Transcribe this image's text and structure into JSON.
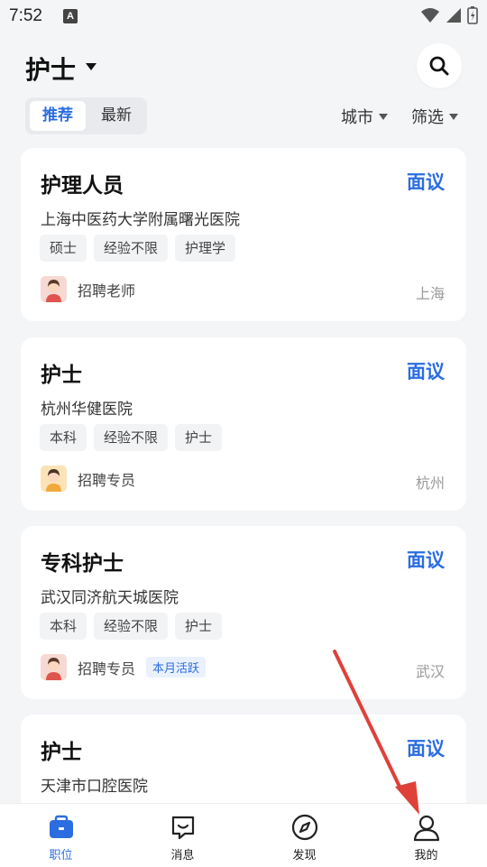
{
  "status": {
    "time": "7:52",
    "notify_glyph": "A"
  },
  "header": {
    "title": "护士"
  },
  "tabs": [
    {
      "label": "推荐"
    },
    {
      "label": "最新"
    }
  ],
  "filters": {
    "city": "城市",
    "filter": "筛选"
  },
  "jobs": [
    {
      "title": "护理人员",
      "salary": "面议",
      "hospital": "上海中医药大学附属曙光医院",
      "tags": [
        "硕士",
        "经验不限",
        "护理学"
      ],
      "recruiter": "招聘老师",
      "badge": "",
      "city": "上海",
      "avatar_color": "#f6d9d2"
    },
    {
      "title": "护士",
      "salary": "面议",
      "hospital": "杭州华健医院",
      "tags": [
        "本科",
        "经验不限",
        "护士"
      ],
      "recruiter": "招聘专员",
      "badge": "",
      "city": "杭州",
      "avatar_color": "#fbe3b8"
    },
    {
      "title": "专科护士",
      "salary": "面议",
      "hospital": "武汉同济航天城医院",
      "tags": [
        "本科",
        "经验不限",
        "护士"
      ],
      "recruiter": "招聘专员",
      "badge": "本月活跃",
      "city": "武汉",
      "avatar_color": "#f6d9d2"
    },
    {
      "title": "护士",
      "salary": "面议",
      "hospital": "天津市口腔医院"
    }
  ],
  "nav": [
    {
      "label": "职位",
      "icon": "briefcase-icon",
      "active": true
    },
    {
      "label": "消息",
      "icon": "message-icon",
      "active": false
    },
    {
      "label": "发现",
      "icon": "compass-icon",
      "active": false
    },
    {
      "label": "我的",
      "icon": "profile-icon",
      "active": false
    }
  ],
  "colors": {
    "accent": "#2b6de0",
    "annotation": "#e0403a"
  }
}
